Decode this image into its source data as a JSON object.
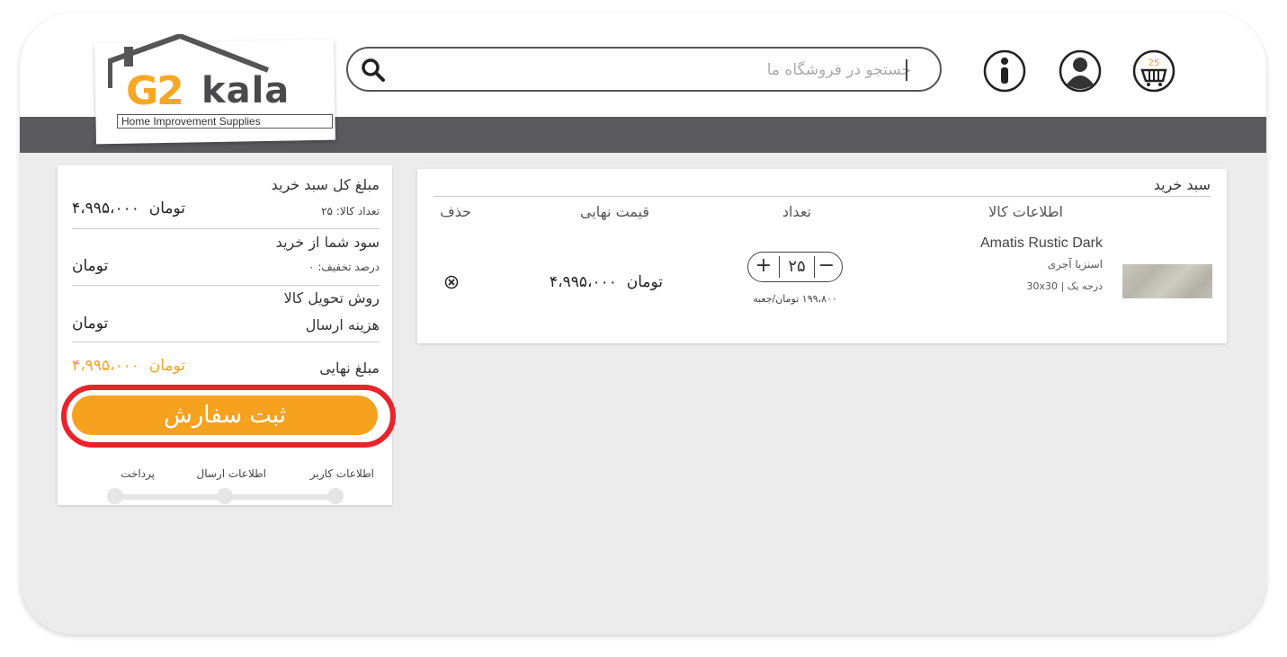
{
  "header": {
    "logo": {
      "brand": "G2kala",
      "subtitle": "Home Improvement Supplies"
    },
    "search": {
      "placeholder": "جستجو در فروشگاه ما"
    },
    "cart_count": "25",
    "icons": [
      "search-icon",
      "info-icon",
      "user-icon",
      "cart-icon"
    ],
    "bar_color": "#5a5a5c"
  },
  "cart": {
    "title": "سبد خرید",
    "columns": {
      "product_info": "اطلاعات کالا",
      "quantity": "تعداد",
      "final_price": "قیمت نهایی",
      "delete": "حذف"
    },
    "items": [
      {
        "name": "Amatis Rustic Dark",
        "type": "اسنزیا آجری",
        "grade": "درجه یک",
        "size": "30x30",
        "quantity": "۲۵",
        "unit_price": "۱۹۹،۸۰۰ تومان/جعبه",
        "final_price": "۴،۹۹۵،۰۰۰",
        "currency": "تومان"
      }
    ]
  },
  "summary": {
    "total_label": "مبلغ کل سبد خرید",
    "count_label": "تعداد کالا: ۲۵",
    "total_value": "۴،۹۹۵،۰۰۰",
    "currency": "تومان",
    "profit_label": "سود شما از خرید",
    "discount_label": "درصد تخفیف: ۰",
    "delivery_label": "روش تحویل کالا",
    "shipping_label": "هزینه ارسال",
    "final_label": "مبلغ نهایی",
    "final_value": "۴،۹۹۵،۰۰۰",
    "order_button": "ثبت سفارش",
    "steps": [
      "اطلاعات کاربر",
      "اطلاعات ارسال",
      "پرداخت"
    ],
    "accent_color": "#f6a21f",
    "highlight_color": "#e8242a"
  }
}
